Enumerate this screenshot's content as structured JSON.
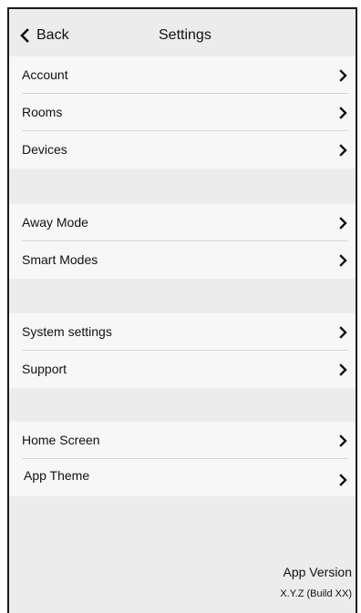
{
  "header": {
    "back_label": "Back",
    "title": "Settings"
  },
  "groups": [
    {
      "items": [
        {
          "label": "Account"
        },
        {
          "label": "Rooms"
        },
        {
          "label": "Devices"
        }
      ]
    },
    {
      "items": [
        {
          "label": "Away Mode"
        },
        {
          "label": "Smart Modes"
        }
      ]
    },
    {
      "items": [
        {
          "label": "System settings"
        },
        {
          "label": "Support"
        }
      ]
    },
    {
      "items": [
        {
          "label": "Home Screen"
        },
        {
          "label": "App Theme"
        }
      ]
    }
  ],
  "footer": {
    "version_label": "App Version",
    "version_value": "X.Y.Z (Build XX)"
  },
  "icons": {
    "back": "chevron-left-icon",
    "row": "chevron-right-icon"
  },
  "colors": {
    "background": "#ececec",
    "row_background": "#f7f7f7",
    "divider": "#d6d6d6",
    "text": "#111111"
  }
}
